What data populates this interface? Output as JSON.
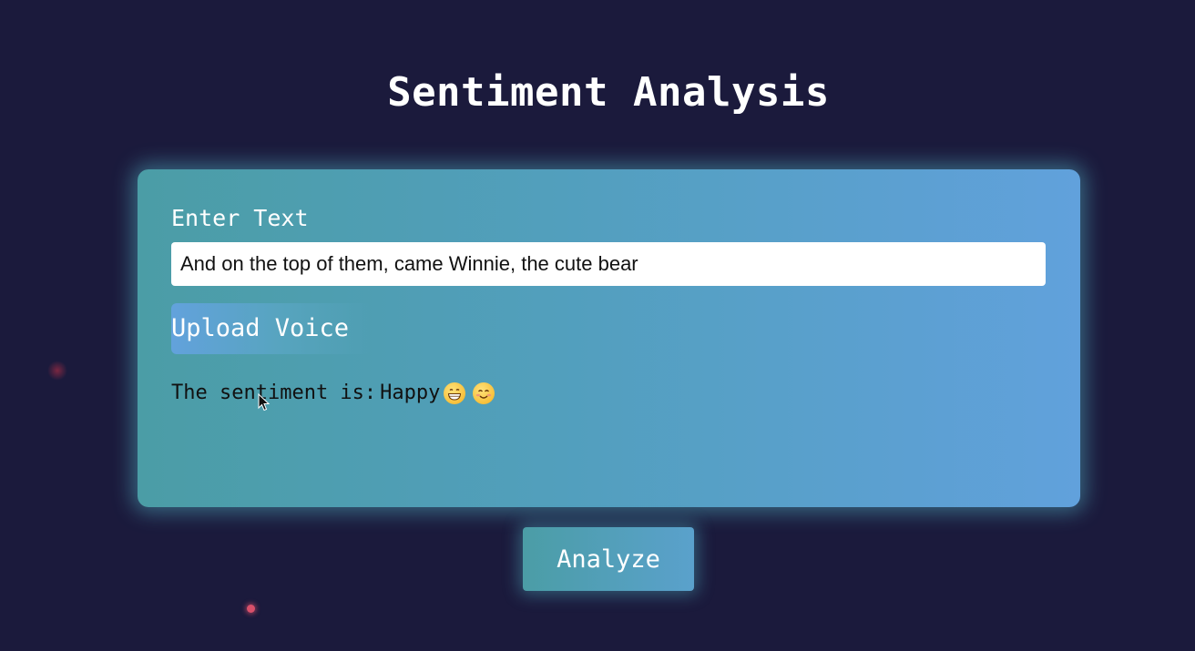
{
  "header": {
    "title": "Sentiment Analysis"
  },
  "form": {
    "text_label": "Enter Text",
    "text_value": "And on the top of them, came Winnie, the cute bear",
    "upload_label": "Upload Voice",
    "result_prefix": "The sentiment is:",
    "result_value": "Happy",
    "result_emojis": [
      "grinning-face-icon",
      "smiling-face-icon"
    ]
  },
  "actions": {
    "analyze_label": "Analyze"
  },
  "colors": {
    "background": "#1b1a3c",
    "card_start": "#4b9da6",
    "card_end": "#61a1dc",
    "glow": "#58c4d2"
  }
}
